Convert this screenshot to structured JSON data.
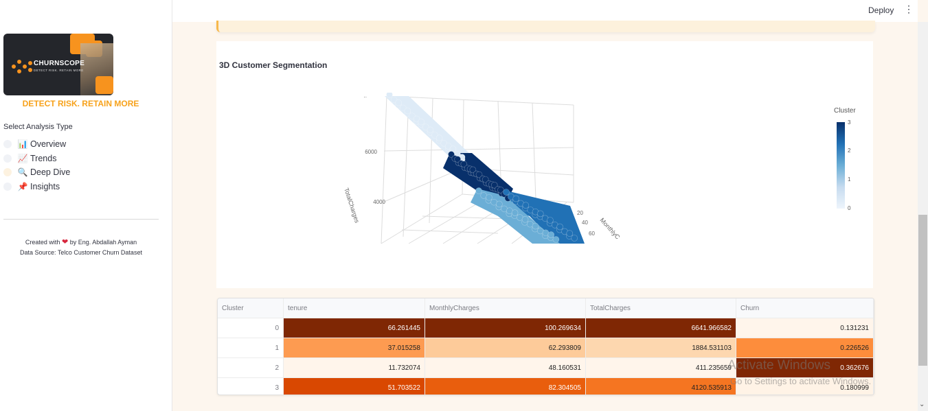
{
  "sidebar": {
    "logo_text": "CHURNSCOPE",
    "logo_subtext": "DETECT RISK. RETAIN MORE",
    "tagline": "DETECT RISK. RETAIN MORE",
    "radio_label": "Select Analysis Type",
    "options": [
      {
        "emoji": "📊",
        "label": "Overview",
        "selected": false
      },
      {
        "emoji": "📈",
        "label": "Trends",
        "selected": false
      },
      {
        "emoji": "🔍",
        "label": "Deep Dive",
        "selected": true
      },
      {
        "emoji": "📌",
        "label": "Insights",
        "selected": false
      }
    ],
    "footer_created_prefix": "Created with",
    "footer_created_suffix": "by Eng. Abdallah Ayman",
    "footer_source": "Data Source: Telco Customer Churn Dataset"
  },
  "header": {
    "deploy_label": "Deploy",
    "menu_icon": "⋮"
  },
  "chart": {
    "title": "3D Customer Segmentation",
    "axis_z_label": "TotalCharges",
    "axis_y_label": "MonthlyC",
    "z_ticks": [
      "6000",
      "4000"
    ],
    "y_ticks": [
      "20",
      "40",
      "60"
    ],
    "colorbar_title": "Cluster",
    "colorbar_ticks": [
      "3",
      "2",
      "1",
      "0"
    ],
    "colors": {
      "0": "#deebf7",
      "1": "#6baed6",
      "2": "#2171b5",
      "3": "#08306b"
    }
  },
  "chart_data": {
    "type": "scatter",
    "title": "3D Customer Segmentation",
    "zlabel": "TotalCharges",
    "ylabel": "MonthlyCharges",
    "color_label": "Cluster",
    "color_range": [
      0,
      3
    ]
  },
  "table": {
    "columns": [
      "Cluster",
      "tenure",
      "MonthlyCharges",
      "TotalCharges",
      "Churn"
    ],
    "rows": [
      {
        "cluster": "0",
        "tenure": "66.261445",
        "monthly": "100.269634",
        "total": "6641.966582",
        "churn": "0.131231"
      },
      {
        "cluster": "1",
        "tenure": "37.015258",
        "monthly": "62.293809",
        "total": "1884.531103",
        "churn": "0.226526"
      },
      {
        "cluster": "2",
        "tenure": "11.732074",
        "monthly": "48.160531",
        "total": "411.235659",
        "churn": "0.362676"
      },
      {
        "cluster": "3",
        "tenure": "51.703522",
        "monthly": "82.304505",
        "total": "4120.535913",
        "churn": "0.180999"
      }
    ],
    "cell_colors": [
      {
        "tenure": "#7f2704",
        "monthly": "#7f2704",
        "total": "#7f2704",
        "churn": "#fff5eb"
      },
      {
        "tenure": "#fd9b51",
        "monthly": "#fdcb9a",
        "total": "#fdd7af",
        "churn": "#fd8d3c"
      },
      {
        "tenure": "#fff5eb",
        "monthly": "#fff5eb",
        "total": "#fff5eb",
        "churn": "#7f2704"
      },
      {
        "tenure": "#d94801",
        "monthly": "#e95e0d",
        "total": "#f57521",
        "churn": "#fff3e6"
      }
    ]
  },
  "watermark": {
    "line1": "Activate Windows",
    "line2": "Go to Settings to activate Windows."
  }
}
